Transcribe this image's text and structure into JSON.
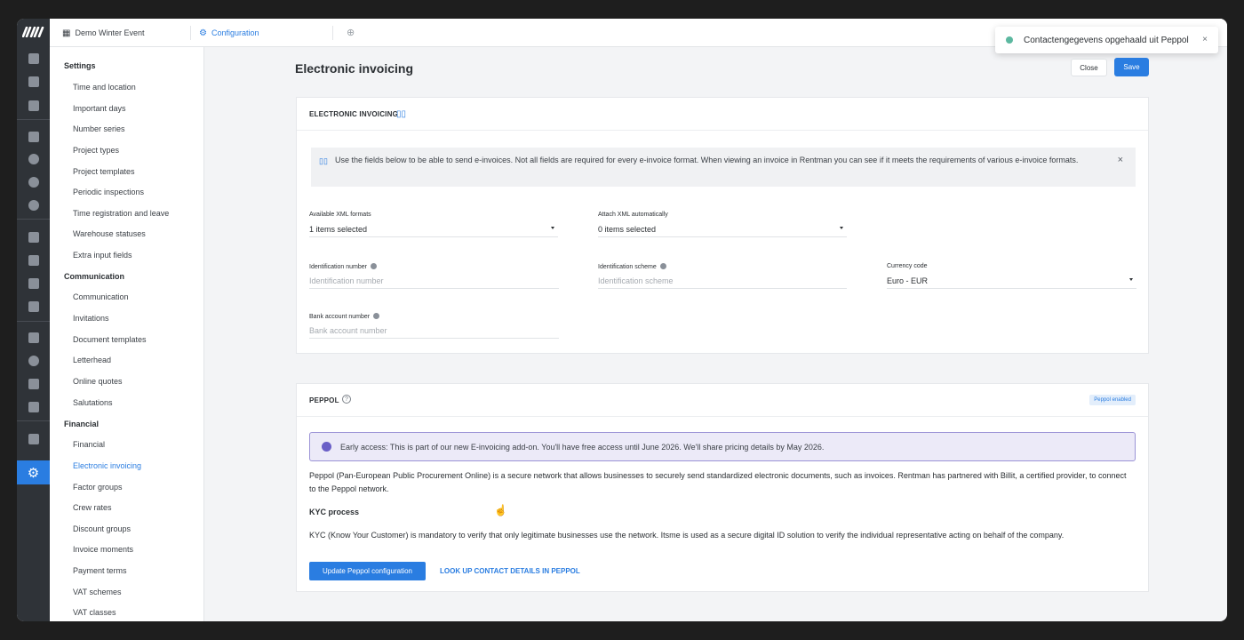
{
  "topbar": {
    "tabs": [
      {
        "label": "Demo Winter Event",
        "icon": "calendar-grid-icon"
      },
      {
        "label": "Configuration",
        "icon": "gear-icon"
      }
    ],
    "add_tab_icon": "plus-circle-icon"
  },
  "toast": {
    "message": "Contactengegevens opgehaald uit Peppol",
    "close": "×",
    "status_color": "#5cb8a0"
  },
  "sidebar": {
    "sections": [
      {
        "header": "Settings",
        "items": [
          "Time and location",
          "Important days",
          "Number series",
          "Project types",
          "Project templates",
          "Periodic inspections",
          "Time registration and leave",
          "Warehouse statuses",
          "Extra input fields"
        ]
      },
      {
        "header": "Communication",
        "items": [
          "Communication",
          "Invitations",
          "Document templates",
          "Letterhead",
          "Online quotes",
          "Salutations"
        ]
      },
      {
        "header": "Financial",
        "items": [
          "Financial",
          "Electronic invoicing",
          "Factor groups",
          "Crew rates",
          "Discount groups",
          "Invoice moments",
          "Payment terms",
          "VAT schemes",
          "VAT classes"
        ]
      }
    ],
    "active_item": "Electronic invoicing"
  },
  "page": {
    "title": "Electronic invoicing",
    "close_label": "Close",
    "save_label": "Save"
  },
  "einvoicing": {
    "header": "ELECTRONIC INVOICING",
    "info_text": "Use the fields below to be able to send e-invoices. Not all fields are required for every e-invoice format. When viewing an invoice in Rentman you can see if it meets the requirements of various e-invoice formats.",
    "info_close": "×",
    "fields": {
      "xml_formats": {
        "label": "Available XML formats",
        "value": "1 items selected"
      },
      "attach_xml": {
        "label": "Attach XML automatically",
        "value": "0 items selected"
      },
      "id_number": {
        "label": "Identification number",
        "placeholder": "Identification number"
      },
      "id_scheme": {
        "label": "Identification scheme",
        "placeholder": "Identification scheme"
      },
      "currency": {
        "label": "Currency code",
        "value": "Euro - EUR"
      },
      "bank_account": {
        "label": "Bank account number",
        "placeholder": "Bank account number"
      }
    }
  },
  "peppol": {
    "header": "PEPPOL",
    "badge": "Peppol enabled",
    "early_access": "Early access: This is part of our new E-invoicing add-on. You'll have free access until June 2026. We'll share pricing details by May 2026.",
    "description": "Peppol (Pan-European Public Procurement Online) is a secure network that allows businesses to securely send standardized electronic documents, such as invoices. Rentman has partnered with Billit, a certified provider, to connect to the Peppol network.",
    "kyc_header": "KYC process",
    "kyc_text": "KYC (Know Your Customer) is mandatory to verify that only legitimate businesses use the network. Itsme is used as a secure digital ID solution to verify the individual representative acting on behalf of the company.",
    "update_button": "Update Peppol configuration",
    "lookup_button": "LOOK UP CONTACT DETAILS IN PEPPOL"
  },
  "colors": {
    "accent": "#2a7de1",
    "rail_bg": "#2f3338",
    "early_access_bg": "#eceaf8",
    "early_access_border": "#9b93d6"
  }
}
